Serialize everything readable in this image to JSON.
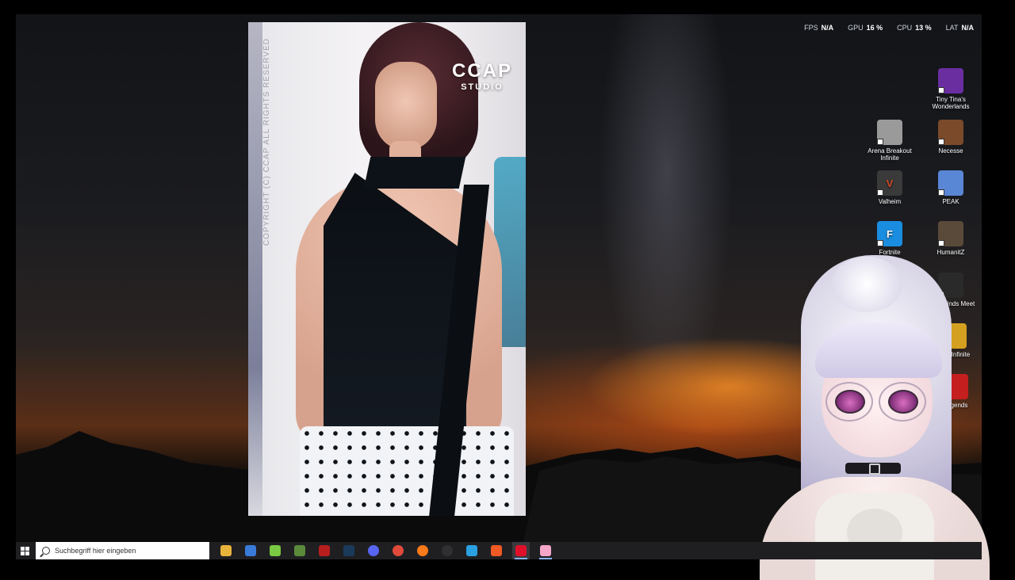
{
  "performance": {
    "fps_label": "FPS",
    "fps_value": "N/A",
    "gpu_label": "GPU",
    "gpu_value": "16 %",
    "cpu_label": "CPU",
    "cpu_value": "13 %",
    "lat_label": "LAT",
    "lat_value": "N/A"
  },
  "photo": {
    "watermark": "COPYRIGHT (C) CCAP ALL RIGHTS RESERVED",
    "logo_line1": "CCAP",
    "logo_line2": "STUDIO"
  },
  "desktop_icons": [
    {
      "label": "Tiny Tina's Wonderlands",
      "icon": "tiny-tinas-wonderlands-icon",
      "color": "#6a2ea0"
    },
    {
      "label": "Arena Breakout Infinite",
      "icon": "arena-breakout-infinite-icon",
      "color": "#9a9a9a"
    },
    {
      "label": "Necesse",
      "icon": "necesse-icon",
      "color": "#7a4a2a"
    },
    {
      "label": "Valheim",
      "icon": "valheim-icon",
      "color": "#3a3a3a"
    },
    {
      "label": "PEAK",
      "icon": "peak-icon",
      "color": "#5a86d6"
    },
    {
      "label": "Fortnite",
      "icon": "fortnite-icon",
      "color": "#1a8de0"
    },
    {
      "label": "HumanitZ",
      "icon": "humanitz-icon",
      "color": "#5a4a3a"
    },
    {
      "label": "here Winds Meet",
      "icon": "where-winds-meet-icon",
      "color": "#2a2a2a"
    },
    {
      "label": "light Infinite",
      "icon": "deadlight-infinite-icon",
      "color": "#d4a020"
    },
    {
      "label": "Legends",
      "icon": "apex-legends-icon",
      "color": "#c41e1e"
    }
  ],
  "search": {
    "placeholder": "Suchbegriff hier eingeben"
  },
  "taskbar_icons": [
    {
      "name": "file-explorer-icon",
      "color": "#e8b33a"
    },
    {
      "name": "store-icon",
      "color": "#3a7ad8"
    },
    {
      "name": "android-app-icon",
      "color": "#7ac943"
    },
    {
      "name": "minecraft-icon",
      "color": "#5a8a3a"
    },
    {
      "name": "game-launcher-icon",
      "color": "#b81e1e"
    },
    {
      "name": "steam-icon",
      "color": "#1a3a5a"
    },
    {
      "name": "discord-icon",
      "color": "#5865f2"
    },
    {
      "name": "chrome-icon",
      "color": "#e14a3a"
    },
    {
      "name": "firefox-icon",
      "color": "#ff7a1a"
    },
    {
      "name": "obs-icon",
      "color": "#303030"
    },
    {
      "name": "app-icon",
      "color": "#2aa0e0"
    },
    {
      "name": "brave-icon",
      "color": "#f05a24"
    },
    {
      "name": "opera-gx-icon",
      "color": "#e0102a"
    },
    {
      "name": "vtube-studio-icon",
      "color": "#f4a6c8"
    }
  ]
}
